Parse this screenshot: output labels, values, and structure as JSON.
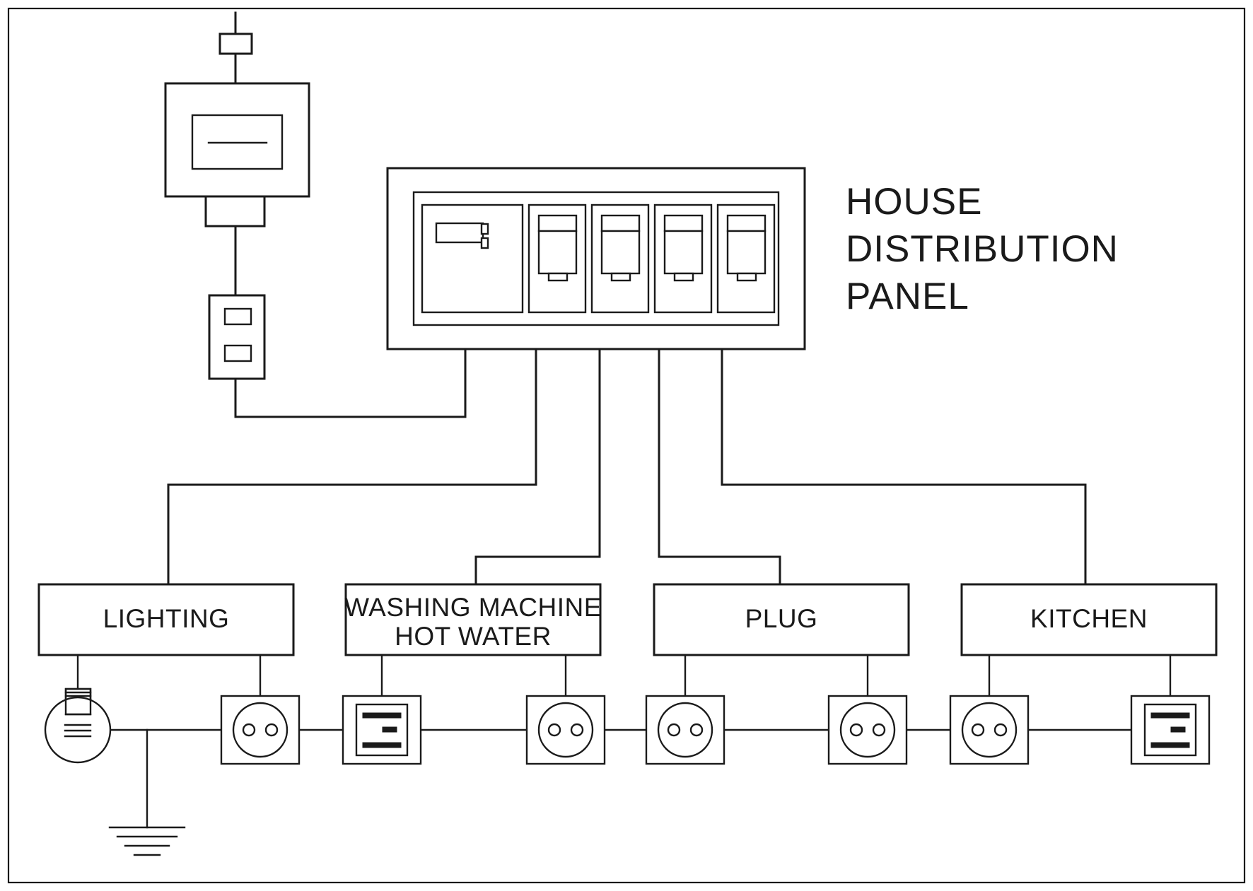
{
  "diagram": {
    "title_lines": [
      "HOUSE",
      "DISTRIBUTION",
      "PANEL"
    ],
    "title_full": "HOUSE DISTRIBUTION PANEL",
    "line_color": "#1a1a1a",
    "background_color": "#ffffff",
    "border_color": "#1a1a1a"
  },
  "supply": {
    "service_fuse_label": "",
    "meter_label": "",
    "isolator_label": ""
  },
  "panel": {
    "main_switch_label": "",
    "breaker_count": 4,
    "breakers": [
      {
        "position": 1,
        "label": ""
      },
      {
        "position": 2,
        "label": ""
      },
      {
        "position": 3,
        "label": ""
      },
      {
        "position": 4,
        "label": ""
      }
    ]
  },
  "circuits": [
    {
      "id": "lighting",
      "label": "LIGHTING",
      "lines": [
        "LIGHTING"
      ]
    },
    {
      "id": "washing-machine-hot-water",
      "label": "WASHING MACHINE HOT WATER",
      "lines": [
        "WASHING MACHINE",
        "HOT WATER"
      ]
    },
    {
      "id": "plug",
      "label": "PLUG",
      "lines": [
        "PLUG"
      ]
    },
    {
      "id": "kitchen",
      "label": "KITCHEN",
      "lines": [
        "KITCHEN"
      ]
    }
  ],
  "devices": [
    {
      "id": "lamp",
      "type": "lamp-icon",
      "label": ""
    },
    {
      "id": "earth",
      "type": "earth-ground-icon",
      "label": ""
    },
    {
      "id": "socket-1",
      "type": "socket-outlet-icon",
      "label": ""
    },
    {
      "id": "switch-1",
      "type": "wall-switch-icon",
      "label": ""
    },
    {
      "id": "socket-2",
      "type": "socket-outlet-icon",
      "label": ""
    },
    {
      "id": "socket-3",
      "type": "socket-outlet-icon",
      "label": ""
    },
    {
      "id": "socket-4",
      "type": "socket-outlet-icon",
      "label": ""
    },
    {
      "id": "socket-5",
      "type": "socket-outlet-icon",
      "label": ""
    },
    {
      "id": "switch-2",
      "type": "wall-switch-icon",
      "label": ""
    }
  ]
}
